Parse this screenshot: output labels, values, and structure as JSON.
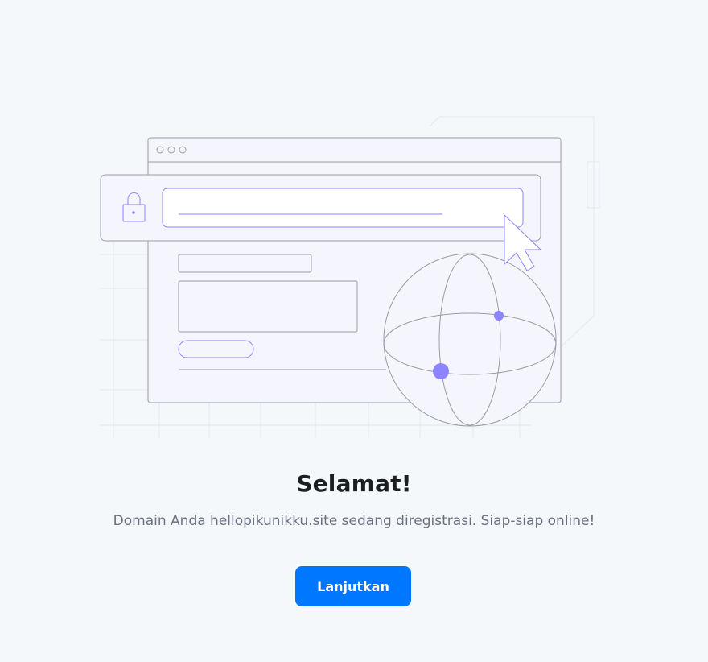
{
  "heading": "Selamat!",
  "message": "Domain Anda hellopikunikku.site sedang diregistrasi. Siap-siap online!",
  "continue_button": "Lanjutkan",
  "colors": {
    "background": "#f4f8fb",
    "accent": "#0077ff",
    "illustration_stroke": "#8c85ff",
    "illustration_dot": "#8c85ff"
  },
  "icons": [
    "browser-window-illustration",
    "lock-icon",
    "cursor-icon",
    "globe-icon"
  ]
}
